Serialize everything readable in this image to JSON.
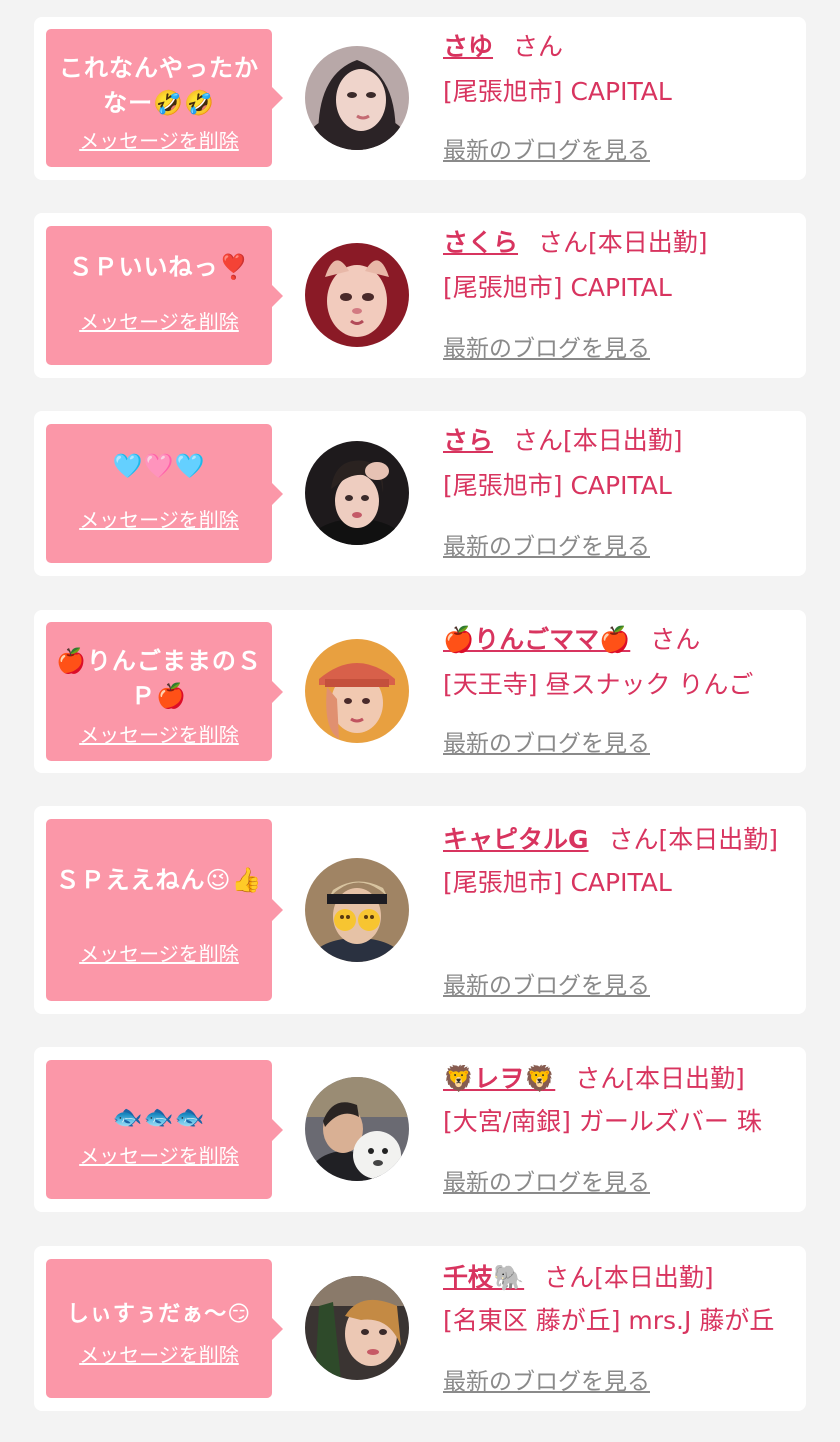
{
  "delete_label": "メッセージを削除",
  "blog_label": "最新のブログを見る",
  "honorific": "さん",
  "items": [
    {
      "message": "これなんやったかなー🤣🤣",
      "name": "さゆ",
      "badge": "",
      "shop": "[尾張旭市] CAPITAL"
    },
    {
      "message": "ＳＰいいねっ❣️",
      "name": "さくら",
      "badge": "[本日出勤]",
      "shop": "[尾張旭市] CAPITAL"
    },
    {
      "message": "🩵🩷🩵",
      "name": "さら",
      "badge": "[本日出勤]",
      "shop": "[尾張旭市] CAPITAL"
    },
    {
      "message": "🍎りんごままのＳＰ🍎",
      "name": "🍎りんごママ🍎",
      "badge": "",
      "shop": "[天王寺] 昼スナック りんご"
    },
    {
      "message": "ＳＰええねん😉👍",
      "name": "キャピタルG",
      "badge": "[本日出勤]",
      "shop": "[尾張旭市] CAPITAL"
    },
    {
      "message": "🐟🐟🐟",
      "name": "🦁レヲ🦁",
      "badge": "[本日出勤]",
      "shop": "[大宮/南銀] ガールズバー 珠"
    },
    {
      "message": "しぃすぅだぁ〜😏",
      "name": "千枝🐘",
      "badge": "[本日出勤]",
      "shop": "[名東区 藤が丘] mrs.J 藤が丘"
    }
  ]
}
